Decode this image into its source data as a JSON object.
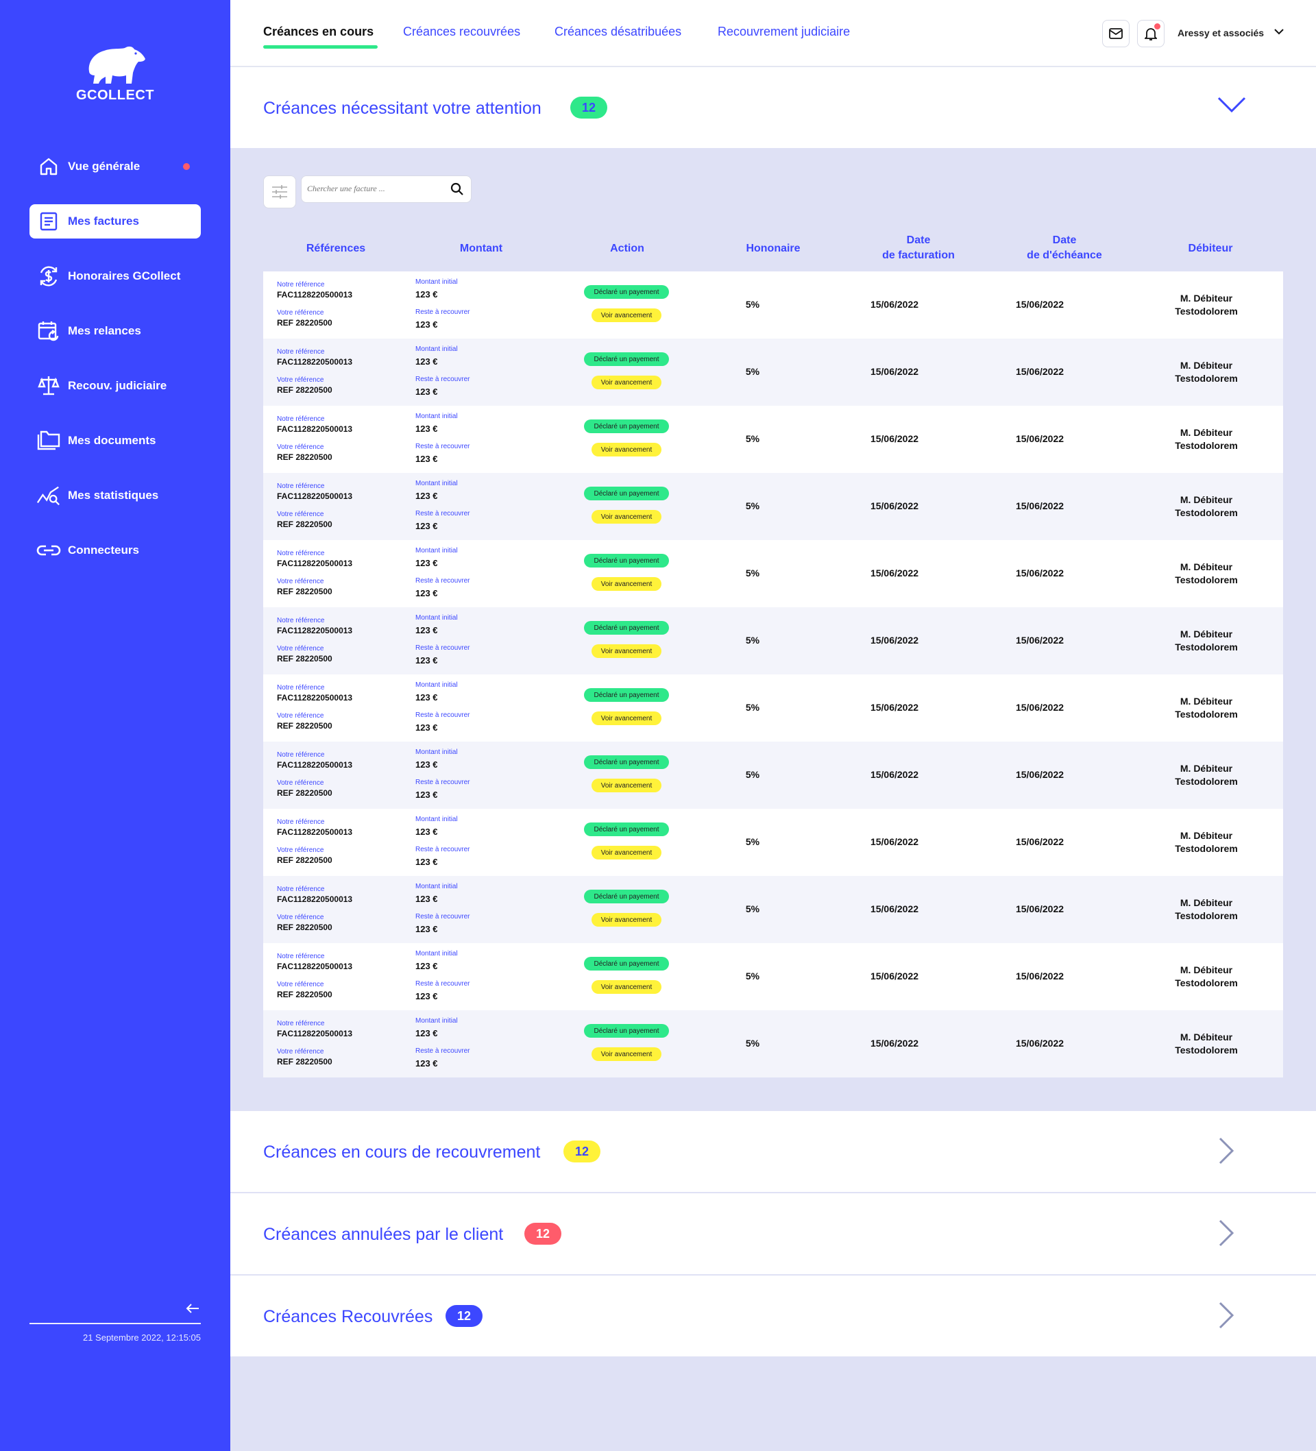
{
  "sidebar": {
    "logo_text": "GCOLLECT",
    "items": [
      {
        "label": "Vue générale",
        "icon": "home-icon"
      },
      {
        "label": "Mes factures",
        "icon": "invoice-icon"
      },
      {
        "label": "Honoraires GCollect",
        "icon": "dollar-cycle-icon"
      },
      {
        "label": "Mes relances",
        "icon": "calendar-refresh-icon"
      },
      {
        "label": "Recouv. judiciaire",
        "icon": "scales-icon"
      },
      {
        "label": "Mes documents",
        "icon": "folder-icon"
      },
      {
        "label": "Mes statistiques",
        "icon": "chart-search-icon"
      },
      {
        "label": "Connecteurs",
        "icon": "link-icon"
      }
    ],
    "active_item": "Mes factures",
    "datetime": "21 Septembre 2022, 12:15:05",
    "collapse_icon": "arrow-left-icon"
  },
  "header": {
    "tabs": [
      "Créances en cours",
      "Créances recouvrées",
      "Créances désatribuées",
      "Recouvrement judiciaire"
    ],
    "active_tab": "Créances en cours",
    "account_name": "Aressy et associés"
  },
  "attention": {
    "title": "Créances nécessitant votre attention",
    "count": "12",
    "badge_color": "#2ee88a"
  },
  "search": {
    "placeholder": "Chercher une facture ..."
  },
  "table": {
    "columns": [
      "Références",
      "Montant",
      "Action",
      "Hononaire",
      "Date\nde facturation",
      "Date\nde d'échéance",
      "Débiteur"
    ],
    "labels": {
      "our_ref": "Notre référence",
      "your_ref": "Votre référence",
      "initial": "Montant initial",
      "remaining": "Reste à recouvrer",
      "declare_btn": "Déclaré un payement",
      "progress_btn": "Voir avancement"
    },
    "rows": [
      {
        "our_ref": "FAC1128220500013",
        "your_ref": "REF 28220500",
        "initial": "123 €",
        "remaining": "123 €",
        "fee": "5%",
        "invoice_date": "15/06/2022",
        "due_date": "15/06/2022",
        "debtor": "M. Débiteur Testodolorem"
      },
      {
        "our_ref": "FAC1128220500013",
        "your_ref": "REF 28220500",
        "initial": "123 €",
        "remaining": "123 €",
        "fee": "5%",
        "invoice_date": "15/06/2022",
        "due_date": "15/06/2022",
        "debtor": "M. Débiteur Testodolorem"
      },
      {
        "our_ref": "FAC1128220500013",
        "your_ref": "REF 28220500",
        "initial": "123 €",
        "remaining": "123 €",
        "fee": "5%",
        "invoice_date": "15/06/2022",
        "due_date": "15/06/2022",
        "debtor": "M. Débiteur Testodolorem"
      },
      {
        "our_ref": "FAC1128220500013",
        "your_ref": "REF 28220500",
        "initial": "123 €",
        "remaining": "123 €",
        "fee": "5%",
        "invoice_date": "15/06/2022",
        "due_date": "15/06/2022",
        "debtor": "M. Débiteur Testodolorem"
      },
      {
        "our_ref": "FAC1128220500013",
        "your_ref": "REF 28220500",
        "initial": "123 €",
        "remaining": "123 €",
        "fee": "5%",
        "invoice_date": "15/06/2022",
        "due_date": "15/06/2022",
        "debtor": "M. Débiteur Testodolorem"
      },
      {
        "our_ref": "FAC1128220500013",
        "your_ref": "REF 28220500",
        "initial": "123 €",
        "remaining": "123 €",
        "fee": "5%",
        "invoice_date": "15/06/2022",
        "due_date": "15/06/2022",
        "debtor": "M. Débiteur Testodolorem"
      },
      {
        "our_ref": "FAC1128220500013",
        "your_ref": "REF 28220500",
        "initial": "123 €",
        "remaining": "123 €",
        "fee": "5%",
        "invoice_date": "15/06/2022",
        "due_date": "15/06/2022",
        "debtor": "M. Débiteur Testodolorem"
      },
      {
        "our_ref": "FAC1128220500013",
        "your_ref": "REF 28220500",
        "initial": "123 €",
        "remaining": "123 €",
        "fee": "5%",
        "invoice_date": "15/06/2022",
        "due_date": "15/06/2022",
        "debtor": "M. Débiteur Testodolorem"
      },
      {
        "our_ref": "FAC1128220500013",
        "your_ref": "REF 28220500",
        "initial": "123 €",
        "remaining": "123 €",
        "fee": "5%",
        "invoice_date": "15/06/2022",
        "due_date": "15/06/2022",
        "debtor": "M. Débiteur Testodolorem"
      },
      {
        "our_ref": "FAC1128220500013",
        "your_ref": "REF 28220500",
        "initial": "123 €",
        "remaining": "123 €",
        "fee": "5%",
        "invoice_date": "15/06/2022",
        "due_date": "15/06/2022",
        "debtor": "M. Débiteur Testodolorem"
      },
      {
        "our_ref": "FAC1128220500013",
        "your_ref": "REF 28220500",
        "initial": "123 €",
        "remaining": "123 €",
        "fee": "5%",
        "invoice_date": "15/06/2022",
        "due_date": "15/06/2022",
        "debtor": "M. Débiteur Testodolorem"
      },
      {
        "our_ref": "FAC1128220500013",
        "your_ref": "REF 28220500",
        "initial": "123 €",
        "remaining": "123 €",
        "fee": "5%",
        "invoice_date": "15/06/2022",
        "due_date": "15/06/2022",
        "debtor": "M. Débiteur Testodolorem"
      }
    ]
  },
  "sections": [
    {
      "title": "Créances en cours de recouvrement",
      "count": "12",
      "badge_color": "#fff23a",
      "badge_text_color": "#3c47ff"
    },
    {
      "title": "Créances annulées par le client",
      "count": "12",
      "badge_color": "#ff5c6b",
      "badge_text_color": "#ffffff"
    },
    {
      "title": "Créances Recouvrées",
      "count": "12",
      "badge_color": "#3c47ff",
      "badge_text_color": "#ffffff"
    }
  ],
  "colors": {
    "accent": "#3c47ff",
    "success": "#2ee88a",
    "warning": "#fff23a",
    "danger": "#ff5c6b",
    "background": "#dfe1f5"
  }
}
